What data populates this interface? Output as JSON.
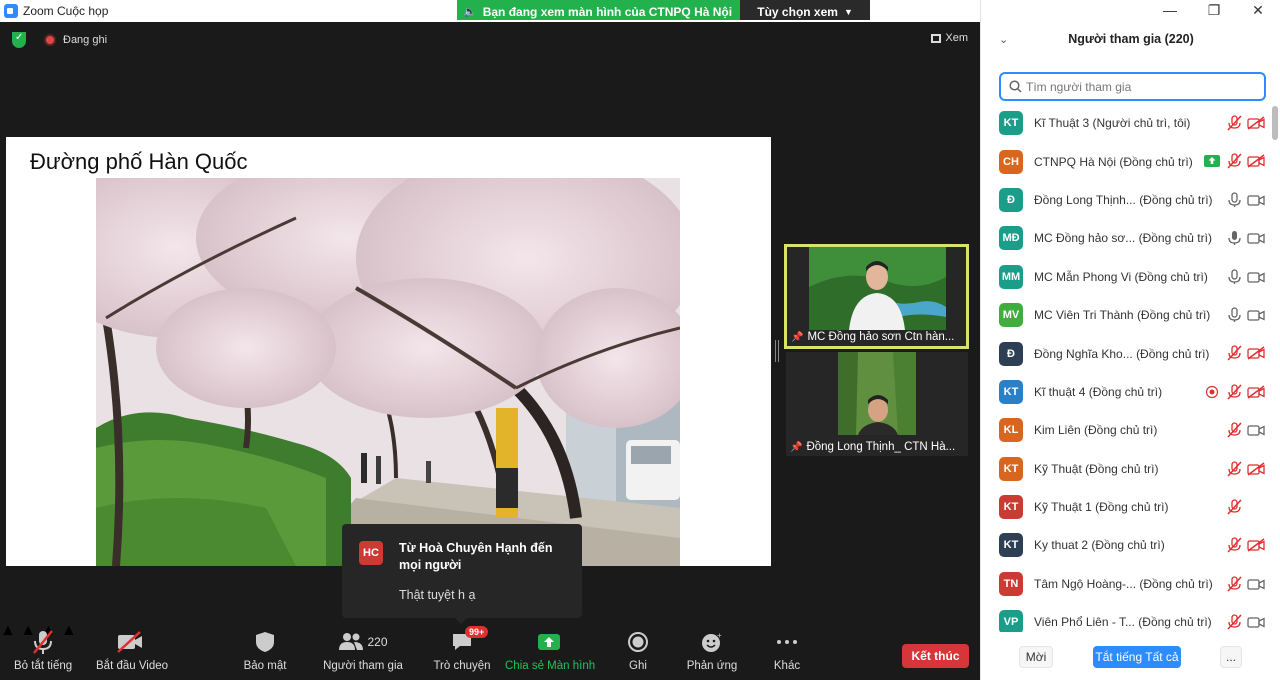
{
  "window": {
    "title": "Zoom Cuộc họp",
    "controls": [
      "—",
      "❐",
      "✕"
    ]
  },
  "share_banner": {
    "text": "Bạn đang xem màn hình của CTNPQ Hà Nội",
    "options_label": "Tùy chọn xem"
  },
  "meeting": {
    "recording_label": "Đang ghi",
    "view_label": "Xem",
    "slide_title": "Đường phố Hàn Quốc"
  },
  "video_tiles": [
    {
      "name": "MC Đồng hảo sơn Ctn hàn...",
      "active": true
    },
    {
      "name": "Đồng Long Thịnh_ CTN Hà...",
      "active": false
    }
  ],
  "chat_toast": {
    "initials": "HC",
    "sender": "Từ Hoà Chuyên Hạnh đến mọi người",
    "message": "Thật tuyệt h ạ"
  },
  "toolbar": {
    "mute_label": "Bỏ tắt tiếng",
    "video_label": "Bắt đầu Video",
    "security_label": "Bảo mật",
    "participants_label": "Người tham gia",
    "participants_count": "220",
    "chat_label": "Trò chuyện",
    "chat_badge": "99+",
    "share_label": "Chia sẻ Màn hình",
    "record_label": "Ghi",
    "reactions_label": "Phản ứng",
    "more_label": "Khác",
    "end_label": "Kết thúc"
  },
  "panel": {
    "title": "Người tham gia (220)",
    "search_placeholder": "Tìm người tham gia",
    "participants": [
      {
        "initials": "KT",
        "color": "#1a9e8a",
        "name": "Kĩ Thuật 3 (Người chủ trì, tôi)",
        "audio": "muted",
        "video": "off",
        "extra": ""
      },
      {
        "initials": "CH",
        "color": "#d9661f",
        "name": "CTNPQ Hà Nội (Đồng chủ trì)",
        "audio": "muted",
        "video": "off",
        "extra": "share"
      },
      {
        "initials": "Đ",
        "color": "#1a9e8a",
        "name": "Đồng Long Thịnh... (Đồng chủ trì)",
        "audio": "on",
        "video": "on",
        "extra": ""
      },
      {
        "initials": "MĐ",
        "color": "#1a9e8a",
        "name": "MC Đồng hảo sơ... (Đồng chủ trì)",
        "audio": "speaking",
        "video": "on",
        "extra": ""
      },
      {
        "initials": "MM",
        "color": "#1a9e8a",
        "name": "MC Mẫn Phong Vi (Đồng chủ trì)",
        "audio": "on",
        "video": "on",
        "extra": ""
      },
      {
        "initials": "MV",
        "color": "#3fae3f",
        "name": "MC Viên Tri Thành (Đồng chủ trì)",
        "audio": "on",
        "video": "on",
        "extra": ""
      },
      {
        "initials": "Đ",
        "color": "#2e3f55",
        "name": "Đồng Nghĩa Kho... (Đồng chủ trì)",
        "audio": "muted",
        "video": "off",
        "extra": ""
      },
      {
        "initials": "KT",
        "color": "#2a7fc9",
        "name": "Kĩ thuật 4 (Đồng chủ trì)",
        "audio": "muted",
        "video": "off",
        "extra": "rec"
      },
      {
        "initials": "KL",
        "color": "#d9661f",
        "name": "Kim Liên (Đồng chủ trì)",
        "audio": "muted",
        "video": "on",
        "extra": ""
      },
      {
        "initials": "KT",
        "color": "#d9661f",
        "name": "Kỹ Thuật (Đồng chủ trì)",
        "audio": "muted",
        "video": "off",
        "extra": ""
      },
      {
        "initials": "KT",
        "color": "#c93b33",
        "name": "Kỹ Thuật 1 (Đồng chủ trì)",
        "audio": "muted",
        "video": "none",
        "extra": ""
      },
      {
        "initials": "KT",
        "color": "#2e3f55",
        "name": "Ky thuat 2 (Đồng chủ trì)",
        "audio": "muted",
        "video": "off",
        "extra": ""
      },
      {
        "initials": "TN",
        "color": "#c93b33",
        "name": "Tâm Ngộ Hoàng-... (Đồng chủ trì)",
        "audio": "muted",
        "video": "on",
        "extra": ""
      },
      {
        "initials": "VP",
        "color": "#1a9e8a",
        "name": "Viên Phổ Liên - T... (Đồng chủ trì)",
        "audio": "muted",
        "video": "on",
        "extra": ""
      }
    ],
    "footer": {
      "invite_label": "Mời",
      "mute_all_label": "Tắt tiếng Tất cả",
      "more_label": "..."
    }
  }
}
